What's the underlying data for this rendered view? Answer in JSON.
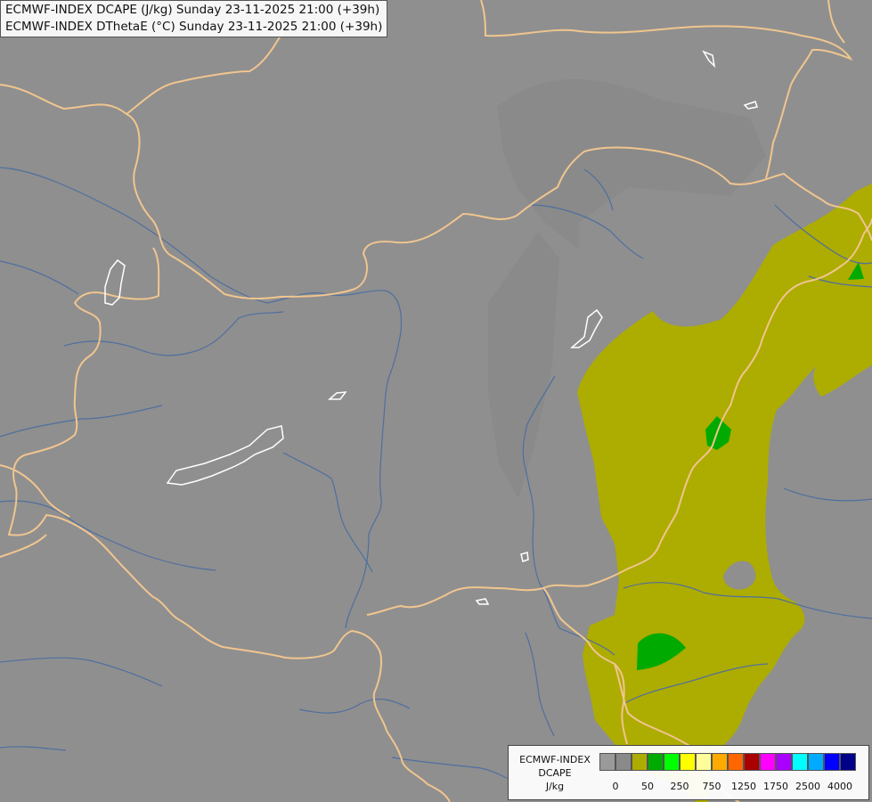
{
  "header": {
    "line1": "ECMWF-INDEX DCAPE (J/kg) Sunday 23-11-2025 21:00 (+39h)",
    "line2": "ECMWF-INDEX DThetaE (°C) Sunday 23-11-2025 21:00 (+39h)"
  },
  "colors": {
    "background": "#8f8f8f",
    "border": "#f0c58f",
    "river": "#4f6f9f",
    "lake_outline": "#ffffff",
    "dcape_50": "#adac00",
    "dcape_250": "#00aa00"
  },
  "map_features": {
    "borders": "country boundaries",
    "rivers": "river network",
    "lakes": "lake outlines"
  },
  "legend": {
    "title_lines": [
      "ECMWF-INDEX",
      "DCAPE",
      "J/kg"
    ],
    "swatch_colors": [
      "#9a9a9a",
      "#8a8a8a",
      "#adac00",
      "#00aa00",
      "#00ff00",
      "#ffff00",
      "#ffff99",
      "#ffaa00",
      "#ff6600",
      "#aa0000",
      "#ff00ff",
      "#aa00ff",
      "#00ffff",
      "#00aaff",
      "#0000ff",
      "#000088"
    ],
    "tick_labels": [
      "0",
      "50",
      "250",
      "750",
      "1250",
      "1750",
      "2500",
      "4000"
    ]
  }
}
